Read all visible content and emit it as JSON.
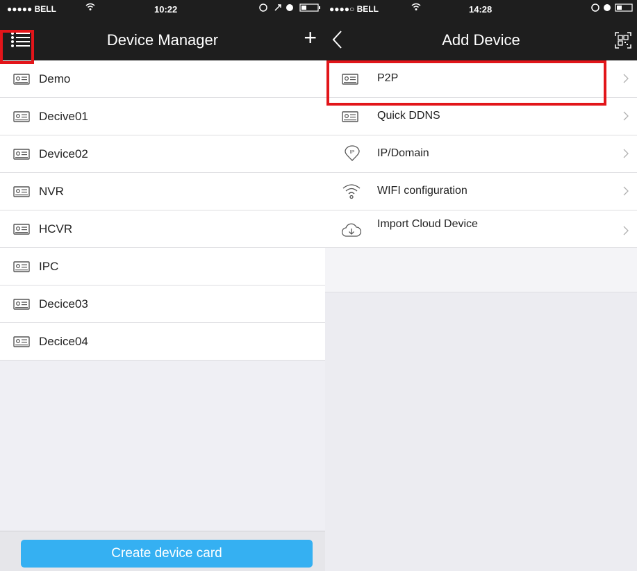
{
  "left": {
    "status": {
      "carrier": "●●●●● BELL",
      "time": "10:22"
    },
    "title": "Device Manager",
    "add_glyph": "+",
    "devices": [
      {
        "label": "Demo",
        "icon": "device-icon"
      },
      {
        "label": "Decive01",
        "icon": "device-icon"
      },
      {
        "label": "Device02",
        "icon": "device-icon"
      },
      {
        "label": "NVR",
        "icon": "device-icon"
      },
      {
        "label": "HCVR",
        "icon": "device-icon"
      },
      {
        "label": "IPC",
        "icon": "device-icon"
      },
      {
        "label": "Decice03",
        "icon": "device-icon"
      },
      {
        "label": "Decice04",
        "icon": "device-icon"
      }
    ],
    "create_button": "Create device card"
  },
  "right": {
    "status": {
      "carrier": "●●●●○ BELL",
      "time": "14:28"
    },
    "title": "Add Device",
    "back_glyph": "<",
    "options": [
      {
        "label": "P2P",
        "icon": "device-icon"
      },
      {
        "label": "Quick DDNS",
        "icon": "device-icon"
      },
      {
        "label": "IP/Domain",
        "icon": "ip-pin-icon"
      },
      {
        "label": "WIFI configuration",
        "icon": "wifi-icon"
      },
      {
        "label": "Import Cloud Device",
        "icon": "cloud-download-icon"
      }
    ]
  },
  "colors": {
    "header": "#1e1e1e",
    "accent": "#35b0f2",
    "highlight": "#e2151a"
  }
}
